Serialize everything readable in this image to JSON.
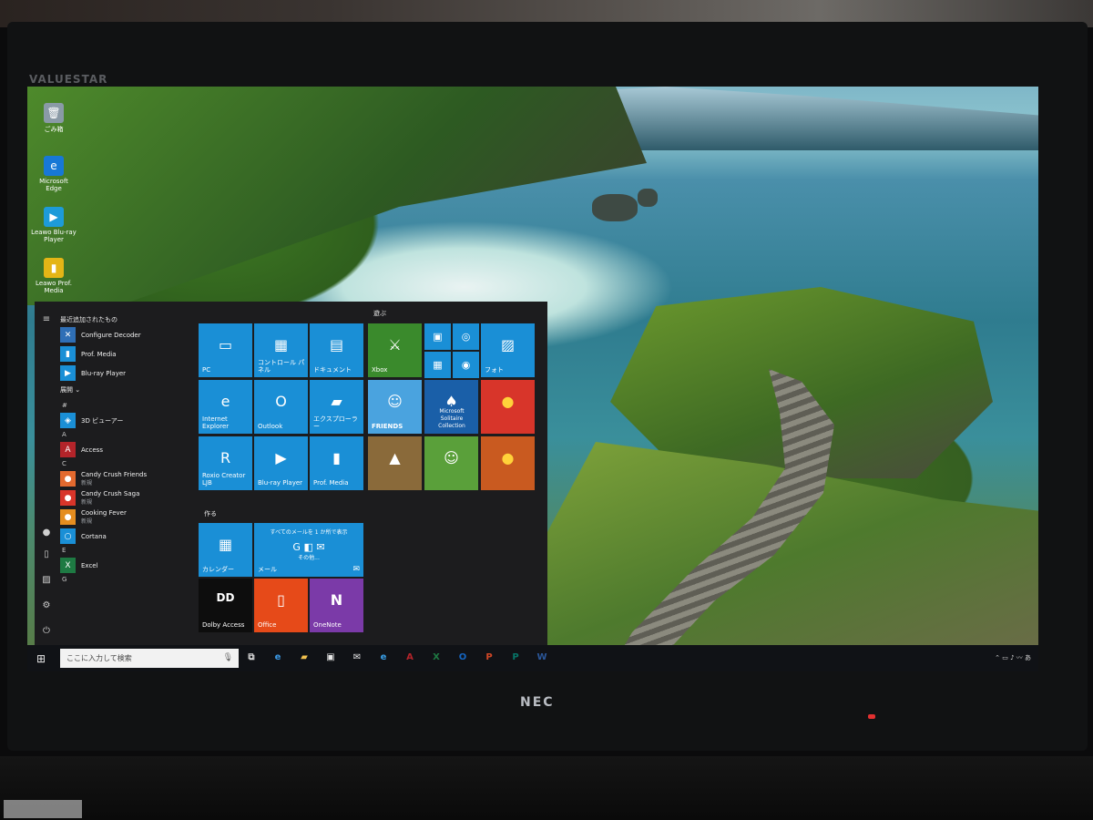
{
  "monitor": {
    "brand_top": "VALUESTAR",
    "brand_bottom": "NEC"
  },
  "desktop_icons": [
    {
      "label": "ごみ箱",
      "icon": "recycle-bin-icon",
      "glyph": "🗑",
      "color": "#8a9aa6"
    },
    {
      "label": "Microsoft Edge",
      "icon": "edge-icon",
      "glyph": "e",
      "color": "#1778d6"
    },
    {
      "label": "Leawo Blu-ray Player",
      "icon": "bluray-player-icon",
      "glyph": "▶",
      "color": "#1d9bd9"
    },
    {
      "label": "Leawo Prof. Media",
      "icon": "prof-media-icon",
      "glyph": "▮",
      "color": "#e4b516"
    }
  ],
  "start_menu": {
    "recent_header": "最近追加されたもの",
    "expand_label": "展開 ⌄",
    "recent_apps": [
      {
        "label": "Configure Decoder",
        "glyph": "✕",
        "color": "#2f6fb6"
      },
      {
        "label": "Prof. Media",
        "glyph": "▮",
        "color": "#1a8fd6"
      },
      {
        "label": "Blu-ray Player",
        "glyph": "▶",
        "color": "#1a8fd6"
      }
    ],
    "sections": [
      {
        "letter": "#",
        "apps": [
          {
            "label": "3D ビューアー",
            "sub": "",
            "glyph": "◈",
            "color": "#1a8fd6"
          }
        ]
      },
      {
        "letter": "A",
        "apps": [
          {
            "label": "Access",
            "sub": "",
            "glyph": "A",
            "color": "#b3242a"
          }
        ]
      },
      {
        "letter": "C",
        "apps": [
          {
            "label": "Candy Crush Friends",
            "sub": "新規",
            "glyph": "●",
            "color": "#e36a2f"
          },
          {
            "label": "Candy Crush Saga",
            "sub": "新規",
            "glyph": "●",
            "color": "#d8352a"
          },
          {
            "label": "Cooking Fever",
            "sub": "新規",
            "glyph": "●",
            "color": "#e58d1f"
          },
          {
            "label": "Cortana",
            "sub": "",
            "glyph": "○",
            "color": "#1a8fd6"
          }
        ]
      },
      {
        "letter": "E",
        "apps": [
          {
            "label": "Excel",
            "sub": "",
            "glyph": "X",
            "color": "#1e7a43"
          }
        ]
      },
      {
        "letter": "G",
        "apps": []
      }
    ],
    "group_create": "作る",
    "group_play": "遊ぶ",
    "tiles_left": [
      {
        "label": "PC",
        "glyph": "▭",
        "color": "#1a8fd6"
      },
      {
        "label": "コントロール パネル",
        "glyph": "▦",
        "color": "#1a8fd6"
      },
      {
        "label": "ドキュメント",
        "glyph": "▤",
        "color": "#1a8fd6"
      },
      {
        "label": "Internet Explorer",
        "glyph": "e",
        "color": "#1a8fd6"
      },
      {
        "label": "Outlook",
        "glyph": "O",
        "color": "#1a8fd6"
      },
      {
        "label": "エクスプローラー",
        "glyph": "▰",
        "color": "#1a8fd6"
      },
      {
        "label": "Roxio Creator LJB",
        "glyph": "R",
        "color": "#1a8fd6"
      },
      {
        "label": "Blu-ray Player",
        "glyph": "▶",
        "color": "#1a8fd6"
      },
      {
        "label": "Prof. Media",
        "glyph": "▮",
        "color": "#1a8fd6"
      }
    ],
    "tiles_create": {
      "calendar": {
        "label": "カレンダー",
        "glyph": "▦",
        "color": "#1a8fd6"
      },
      "mail": {
        "title": "すべてのメールを 1 か所で表示",
        "more": "その他...",
        "label": "メール",
        "glyph": "✉",
        "color": "#1a8fd6"
      },
      "dolby": {
        "label": "Dolby Access",
        "glyph": "DD",
        "color": "#0d0d0d"
      },
      "office": {
        "label": "Office",
        "glyph": "▯",
        "color": "#e64a19"
      },
      "onenote": {
        "label": "OneNote",
        "glyph": "N",
        "color": "#7b3aa8"
      }
    },
    "tiles_play": {
      "xbox": {
        "label": "Xbox",
        "glyph": "⚔",
        "color": "#3a8a2c"
      },
      "mini": [
        {
          "glyph": "▣",
          "name": "movies-icon"
        },
        {
          "glyph": "◎",
          "name": "groove-icon"
        },
        {
          "glyph": "▦",
          "name": "calculator-icon"
        },
        {
          "glyph": "◉",
          "name": "camera-icon"
        }
      ],
      "photos": {
        "label": "フォト",
        "glyph": "▨",
        "color": "#1a8fd6"
      },
      "friends": {
        "label": "FRIENDS",
        "glyph": "☺",
        "color": "#4aa3df"
      },
      "solitaire": {
        "label": "Microsoft Solitaire Collection",
        "glyph": "♠",
        "color": "#1a5fa8"
      },
      "candy": {
        "glyph": "●",
        "color": "#d8352a"
      },
      "game1": {
        "glyph": "▲",
        "color": "#8a6a3a"
      },
      "gardenscapes": {
        "glyph": "☺",
        "color": "#5aa03a"
      },
      "cooking": {
        "glyph": "●",
        "color": "#c95a20"
      }
    }
  },
  "taskbar": {
    "search_placeholder": "ここに入力して検索",
    "icons": [
      {
        "name": "task-view-icon",
        "glyph": "⧉",
        "color": "#d8d8d8"
      },
      {
        "name": "edge-icon",
        "glyph": "e",
        "color": "#3b9be8"
      },
      {
        "name": "explorer-icon",
        "glyph": "▰",
        "color": "#f2c14e"
      },
      {
        "name": "store-icon",
        "glyph": "▣",
        "color": "#e8e8e8"
      },
      {
        "name": "mail-icon",
        "glyph": "✉",
        "color": "#e8e8e8"
      },
      {
        "name": "ie-icon",
        "glyph": "e",
        "color": "#3aa0e8"
      },
      {
        "name": "access-icon",
        "glyph": "A",
        "color": "#b3242a"
      },
      {
        "name": "excel-icon",
        "glyph": "X",
        "color": "#1e7a43"
      },
      {
        "name": "outlook-icon",
        "glyph": "O",
        "color": "#1565c0"
      },
      {
        "name": "powerpoint-icon",
        "glyph": "P",
        "color": "#d24726"
      },
      {
        "name": "publisher-icon",
        "glyph": "P",
        "color": "#077568"
      },
      {
        "name": "word-icon",
        "glyph": "W",
        "color": "#2b579a"
      }
    ],
    "tray": "⌃ ▭ ♪ 〰 あ"
  }
}
